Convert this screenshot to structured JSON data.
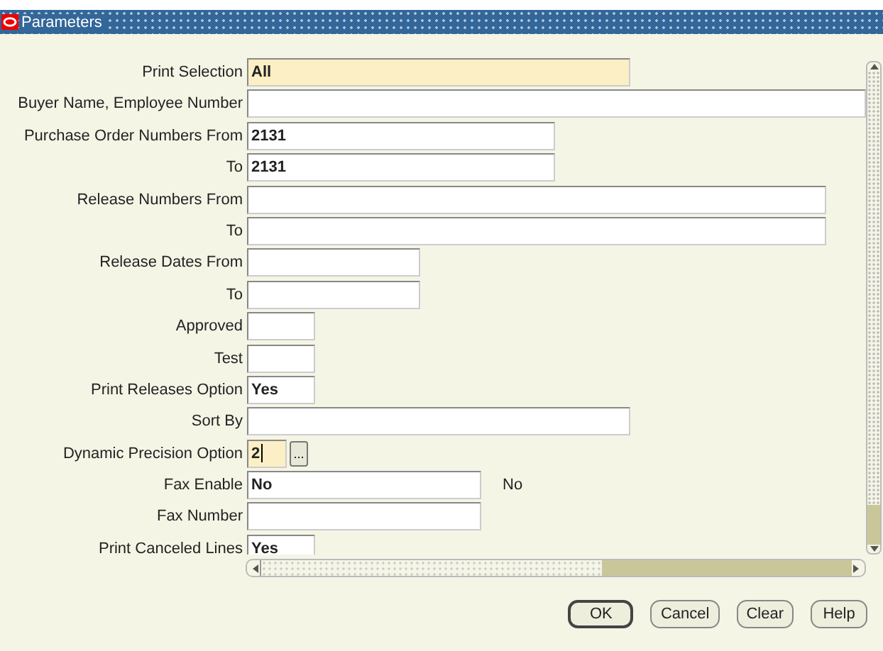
{
  "window": {
    "title": "Parameters"
  },
  "fields": [
    {
      "label": "Print Selection",
      "value": "All",
      "highlighted": true,
      "kind": "text"
    },
    {
      "label": "Buyer Name, Employee Number",
      "highlighted": false,
      "kind": "text"
    },
    {
      "label": "Purchase Order Numbers From",
      "value": "2131",
      "highlighted": false,
      "kind": "text"
    },
    {
      "label": "To",
      "value": "2131",
      "highlighted": false,
      "kind": "text"
    },
    {
      "label": "Release Numbers From",
      "highlighted": false,
      "kind": "text"
    },
    {
      "label": "To",
      "highlighted": false,
      "kind": "text"
    },
    {
      "label": "Release Dates From",
      "highlighted": false,
      "kind": "text"
    },
    {
      "label": "To",
      "highlighted": false,
      "kind": "text"
    },
    {
      "label": "Approved",
      "highlighted": false,
      "kind": "text"
    },
    {
      "label": "Test",
      "highlighted": false,
      "kind": "text"
    },
    {
      "label": "Print Releases Option",
      "value": "Yes",
      "highlighted": false,
      "kind": "text"
    },
    {
      "label": "Sort By",
      "highlighted": false,
      "kind": "text"
    },
    {
      "label": "Dynamic Precision Option",
      "value": "2",
      "highlighted": true,
      "kind": "lov",
      "button": "..."
    },
    {
      "label": "Fax Enable",
      "value": "No",
      "highlighted": false,
      "kind": "text",
      "description": "No"
    },
    {
      "label": "Fax Number",
      "highlighted": false,
      "kind": "text"
    },
    {
      "label": "Print Canceled Lines",
      "value": "Yes",
      "highlighted": false,
      "kind": "text"
    }
  ],
  "buttons": [
    "OK",
    "Cancel",
    "Clear",
    "Help"
  ]
}
